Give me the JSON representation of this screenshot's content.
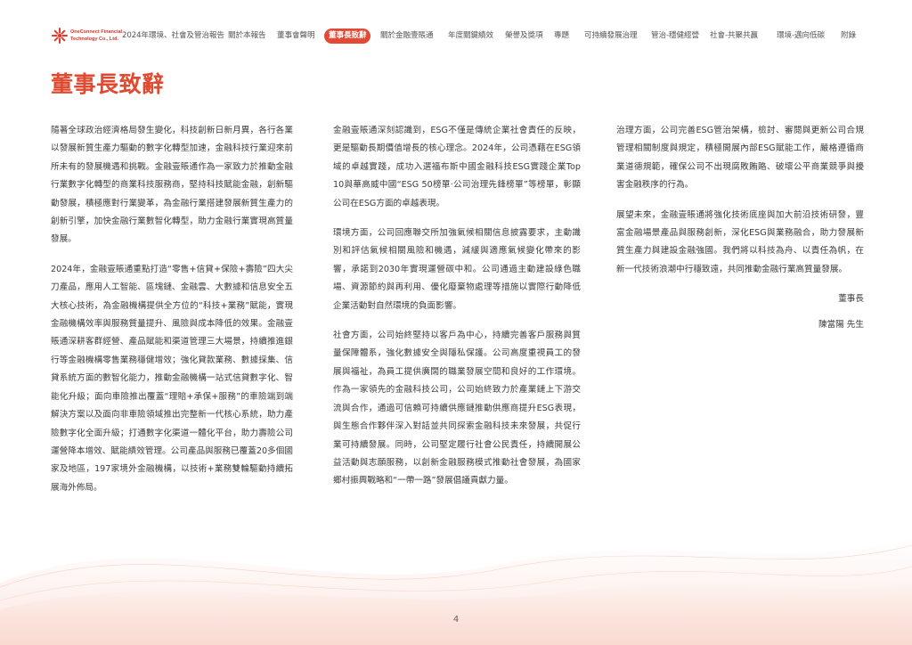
{
  "header": {
    "logo_line1": "OneConnect Financial",
    "logo_line2": "Technology Co., Ltd.",
    "nav_items": [
      {
        "label": "2024年環境、社會及管治報告"
      },
      {
        "label": "關於本報告"
      },
      {
        "label": "董事會聲明"
      },
      {
        "label": "董事長致辭"
      },
      {
        "label": "關於金融壹賬通"
      },
      {
        "label": "年度關鍵績效"
      },
      {
        "label": "榮譽及獎項"
      },
      {
        "label": "專題"
      },
      {
        "label": "可持續發展治理"
      },
      {
        "label": "管治-穩健經營"
      },
      {
        "label": "社會-共聚共贏"
      },
      {
        "label": "環境-邁向低碳"
      },
      {
        "label": "附錄"
      }
    ],
    "active_index": 3,
    "accent_color": "#e24a35"
  },
  "title": "董事長致辭",
  "columns": [
    {
      "paragraphs": [
        "隨著全球政治經濟格局發生變化，科技創新日新月異，各行各業以發展新質生產力驅動的數字化轉型加速，金融科技行業迎來前所未有的發展機遇和挑戰。金融壹賬通作為一家致力於推動金融行業數字化轉型的商業科技服務商，堅持科技賦能金融，創新驅動發展，積極應對行業變革，為金融行業搭建發展新質生產力的創新引擎，加快金融行業數智化轉型，助力金融行業實現高質量發展。",
        "2024年，金融壹賬通重點打造“零售+信貸+保險+壽險”四大尖刀產品，應用人工智能、區塊鏈、金融雲、大數據和信息安全五大核心技術，為金融機構提供全方位的“科技+業務”賦能，實現金融機構效率與服務質量提升、風險與成本降低的效果。金融壹賬通深耕客群經營、產品賦能和渠道管理三大場景，持續推進銀行等金融機構零售業務穩健增效；強化貸款業務、數據採集、信貸系統方面的數智化能力，推動金融機構一站式信貸數字化、智能化升級；面向車險推出覆蓋“理賠+承保+服務”的車險端到端解決方案以及面向非車險領域推出完整新一代核心系統，助力產險數字化全面升級；打通數字化渠道一體化平台，助力壽險公司運營降本增效、賦能績效管理。公司產品與服務已覆蓋20多個國家及地區，197家境外金融機構，以技術+業務雙輪驅動持續拓展海外佈局。"
      ]
    },
    {
      "paragraphs": [
        "金融壹賬通深刻認識到，ESG不僅是傳統企業社會責任的反映，更是驅動長期價值增長的核心理念。2024年，公司憑藉在ESG領域的卓越實踐，成功入選福布斯中國金融科技ESG實踐企業Top 10與華高威中國“ESG 50榜單·公司治理先鋒榜單”等榜單，彰顯公司在ESG方面的卓越表現。",
        "環境方面，公司回應聯交所加強氣候相關信息披露要求，主動識別和評估氣候相關風險和機遇，減緩與適應氣候變化帶來的影響，承諾到2030年實現運營碳中和。公司通過主動建設綠色職場、資源節約與再利用、優化廢棄物處理等措施以實際行動降低企業活動對自然環境的負面影響。",
        "社會方面，公司始終堅持以客戶為中心，持續完善客戶服務與質量保障體系，強化數據安全與隱私保護。公司高度重視員工的發展與福祉，為員工提供廣闊的職業發展空間和良好的工作環境。作為一家領先的金融科技公司，公司始終致力於產業鏈上下游交流與合作，通過可信賴可持續供應鏈推動供應商提升ESG表現，與生態合作夥伴深入對話並共同探索金融科技未來發展，共促行業可持續發展。同時，公司堅定履行社會公民責任，持續開展公益活動與志願服務，以創新金融服務模式推動社會發展，為國家鄉村振興戰略和“一帶一路”發展倡議貢獻力量。"
      ]
    },
    {
      "paragraphs": [
        "治理方面，公司完善ESG管治架構，檢討、審閱與更新公司合規管理相關制度與規定，積極開展內部ESG賦能工作，嚴格遵循商業道德規範，確保公司不出現腐敗賄賂、破壞公平商業競爭與擾害金融秩序的行為。",
        "展望未來，金融壹賬通將強化技術底座與加大前沿技術研發，豐富金融場景產品與服務創新，深化ESG與業務融合，助力發展新質生產力與建設金融強國。我們將以科技為舟、以責任為帆，在新一代技術浪潮中行穩致遠，共同推動金融行業高質量發展。"
      ],
      "signature_title": "董事長",
      "signature_name": "陳當陽 先生"
    }
  ],
  "page_number": "4"
}
